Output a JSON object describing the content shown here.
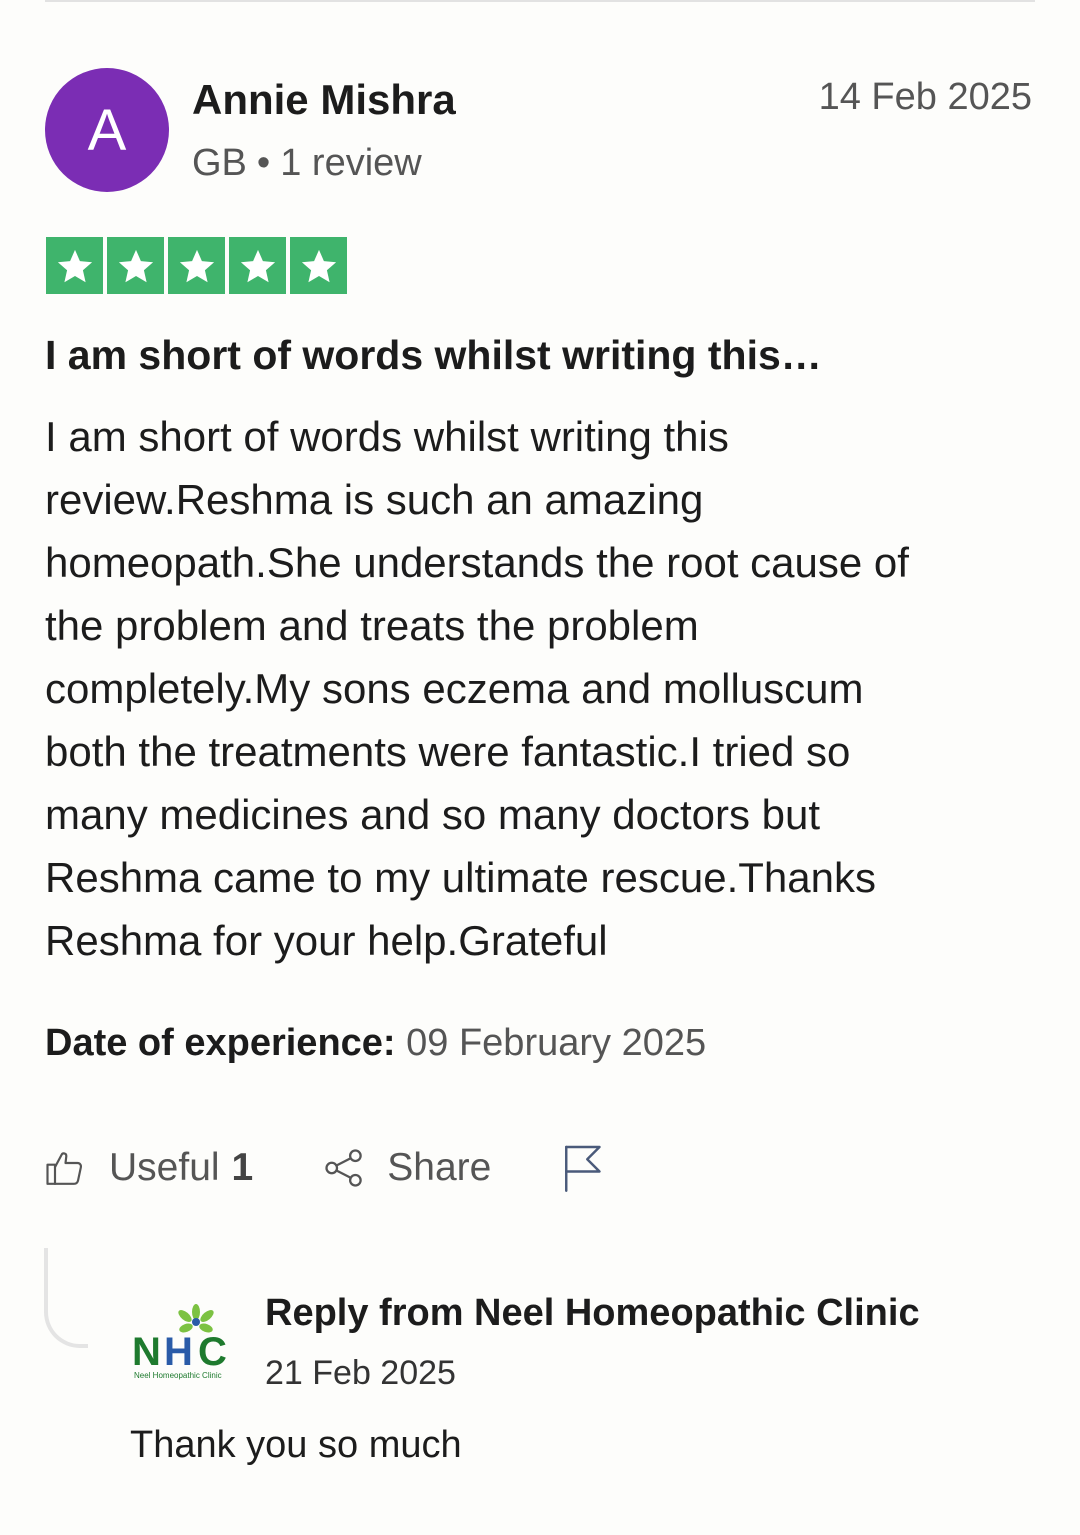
{
  "review": {
    "reviewer": {
      "initial": "A",
      "name": "Annie Mishra",
      "country": "GB",
      "separator": "•",
      "review_count": "1 review"
    },
    "date": "14 Feb 2025",
    "rating": 5,
    "rating_max": 5,
    "title": "I am short of words whilst writing this…",
    "body_lines": [
      "I am short of words whilst writing this",
      "review.Reshma is such an amazing",
      "homeopath.She understands the root cause of",
      "the problem and treats the problem",
      "completely.My sons eczema and molluscum",
      "both the treatments were fantastic.I tried so",
      "many medicines and so many doctors but",
      "Reshma came to my ultimate rescue.Thanks",
      "Reshma for your help.Grateful"
    ],
    "experience": {
      "label": "Date of experience:",
      "value": "09 February 2025"
    }
  },
  "actions": {
    "useful_label": "Useful",
    "useful_count": "1",
    "share_label": "Share",
    "report_icon": "flag-icon"
  },
  "reply": {
    "title": "Reply from Neel Homeopathic Clinic",
    "date": "21 Feb 2025",
    "text": "Thank you so much",
    "logo": {
      "initials": "NHC",
      "caption": "Neel Homeopathic Clinic"
    }
  },
  "colors": {
    "star_green": "#3fb46c",
    "avatar_purple": "#7b2db4",
    "logo_green": "#1e7a2e",
    "logo_blue": "#2a5ba8"
  }
}
